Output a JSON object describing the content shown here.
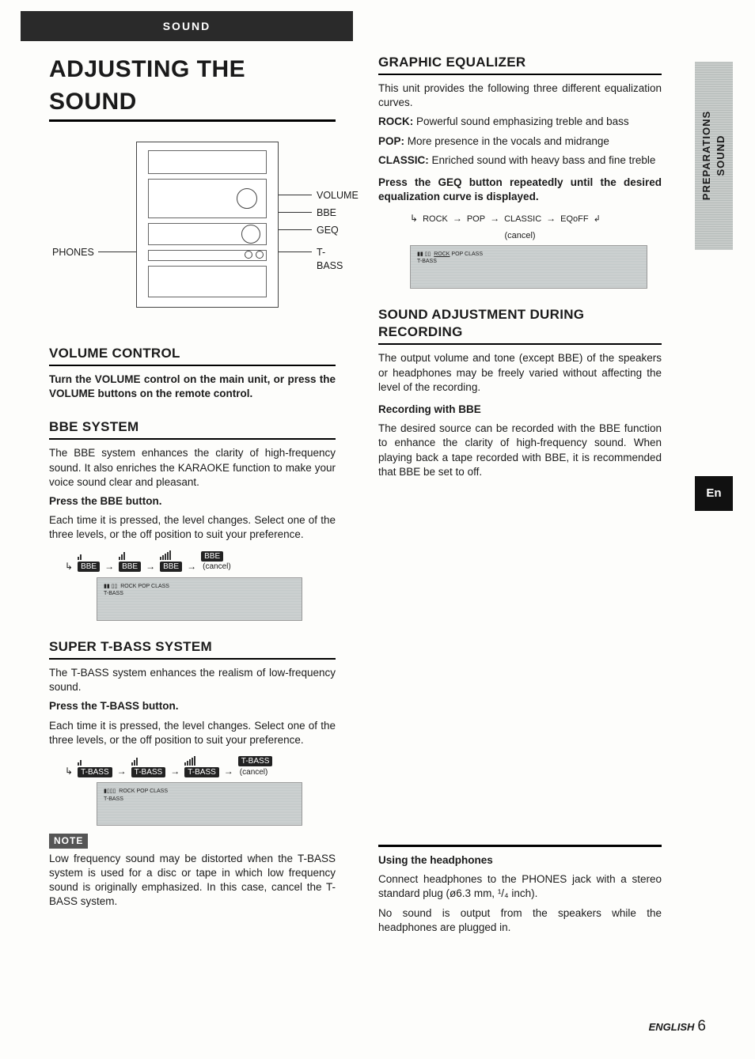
{
  "header": {
    "tab": "SOUND"
  },
  "left": {
    "title": "ADJUSTING THE SOUND",
    "device_labels": {
      "phones": "PHONES",
      "volume": "VOLUME",
      "bbe": "BBE",
      "geq": "GEQ",
      "tbass": "T-BASS"
    },
    "volume": {
      "heading": "VOLUME CONTROL",
      "body": "Turn the VOLUME control on the main unit, or press the VOLUME buttons on the remote control."
    },
    "bbe": {
      "heading": "BBE SYSTEM",
      "intro": "The BBE system enhances the clarity of high-frequency sound. It also enriches the KARAOKE function to make your voice sound clear and pleasant.",
      "press": "Press the BBE button.",
      "body": "Each time it is pressed, the level changes. Select one of the three levels, or the off position to suit your preference.",
      "seq": [
        "BBE",
        "BBE",
        "BBE",
        "BBE"
      ],
      "cancel": "(cancel)"
    },
    "tbass": {
      "heading": "SUPER T-BASS SYSTEM",
      "intro": "The T-BASS system enhances the realism of low-frequency sound.",
      "press": "Press the T-BASS button.",
      "body": "Each time it is pressed, the level changes. Select one of the three levels, or the off position to suit your preference.",
      "seq": [
        "T-BASS",
        "T-BASS",
        "T-BASS",
        "T-BASS"
      ],
      "cancel": "(cancel)"
    },
    "note": {
      "tag": "NOTE",
      "body": "Low frequency sound may be distorted when the T-BASS system is used for a disc or tape in which low frequency sound is originally emphasized. In this case, cancel the T-BASS system."
    }
  },
  "right": {
    "geq": {
      "heading": "GRAPHIC EQUALIZER",
      "intro": "This unit provides the following three different equalization curves.",
      "rock_label": "ROCK:",
      "rock": "Powerful sound emphasizing treble and bass",
      "pop_label": "POP:",
      "pop": "More presence in the vocals and midrange",
      "classic_label": "CLASSIC:",
      "classic": "Enriched sound with heavy bass and fine treble",
      "press": "Press the GEQ button repeatedly until the desired equalization curve is displayed.",
      "seq": [
        "ROCK",
        "POP",
        "CLASSIC",
        "EQoFF"
      ],
      "cancel": "(cancel)"
    },
    "rec": {
      "heading": "SOUND ADJUSTMENT DURING RECORDING",
      "body": "The output volume and tone (except BBE) of the speakers or headphones may be freely varied without affecting the level of the recording.",
      "sub": "Recording with BBE",
      "sub_body": "The desired source can be recorded with the BBE function to enhance the clarity of high-frequency sound. When playing back a tape recorded with BBE, it is recommended that BBE be set to off."
    },
    "headphones": {
      "heading": "Using the headphones",
      "l1": "Connect headphones to the PHONES jack with a stereo standard plug (ø6.3 mm, ¹/₄ inch).",
      "l2": "No sound is output from the speakers while the headphones are plugged in."
    }
  },
  "side": {
    "line1": "PREPARATIONS",
    "line2": "SOUND"
  },
  "en_tab": "En",
  "footer": {
    "lang": "ENGLISH",
    "page": "6"
  }
}
